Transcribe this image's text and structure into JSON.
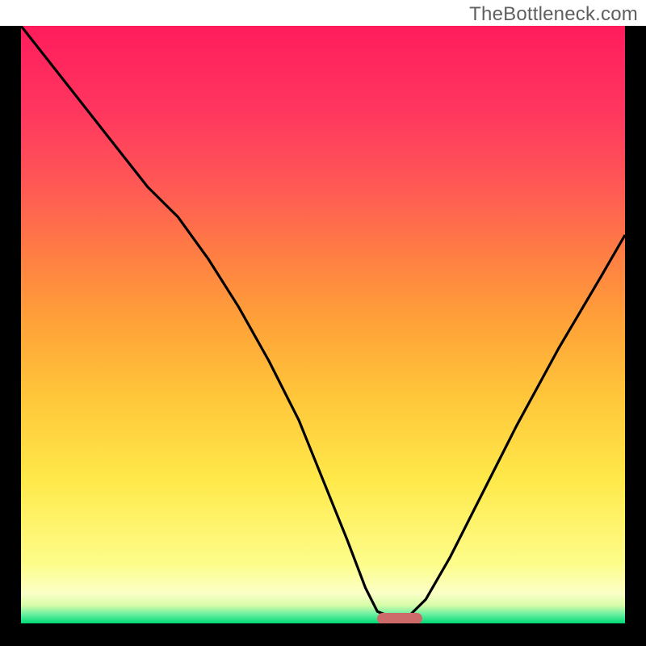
{
  "watermark": "TheBottleneck.com",
  "chart_data": {
    "type": "line",
    "title": "",
    "xlabel": "",
    "ylabel": "",
    "xlim": [
      0,
      100
    ],
    "ylim": [
      0,
      100
    ],
    "legend": false,
    "grid": false,
    "annotations": [],
    "background_gradient": {
      "orientation": "vertical",
      "stops": [
        {
          "pos": 0.0,
          "color": "#00d977"
        },
        {
          "pos": 0.016,
          "color": "#6ff0a2"
        },
        {
          "pos": 0.03,
          "color": "#d6fca8"
        },
        {
          "pos": 0.05,
          "color": "#fbffc7"
        },
        {
          "pos": 0.1,
          "color": "#fdfd8a"
        },
        {
          "pos": 0.24,
          "color": "#ffe94a"
        },
        {
          "pos": 0.38,
          "color": "#ffc63a"
        },
        {
          "pos": 0.5,
          "color": "#ffa338"
        },
        {
          "pos": 0.62,
          "color": "#ff7d44"
        },
        {
          "pos": 0.74,
          "color": "#ff5656"
        },
        {
          "pos": 0.86,
          "color": "#ff365f"
        },
        {
          "pos": 1.0,
          "color": "#ff1c5c"
        }
      ]
    },
    "series": [
      {
        "name": "bottleneck-curve",
        "x": [
          0,
          7,
          14,
          21,
          26,
          31,
          36,
          41,
          46,
          50,
          54,
          57,
          59,
          61.5,
          64,
          67,
          71,
          76,
          82,
          89,
          96,
          100
        ],
        "y": [
          100,
          91,
          82,
          73,
          68,
          61,
          53,
          44,
          34,
          24,
          14,
          6,
          2,
          1,
          1,
          4,
          11,
          21,
          33,
          46,
          58,
          65
        ]
      }
    ],
    "marker": {
      "x_start": 59,
      "x_end": 66.5,
      "y": 0.8,
      "color": "#cc6b6a"
    }
  }
}
